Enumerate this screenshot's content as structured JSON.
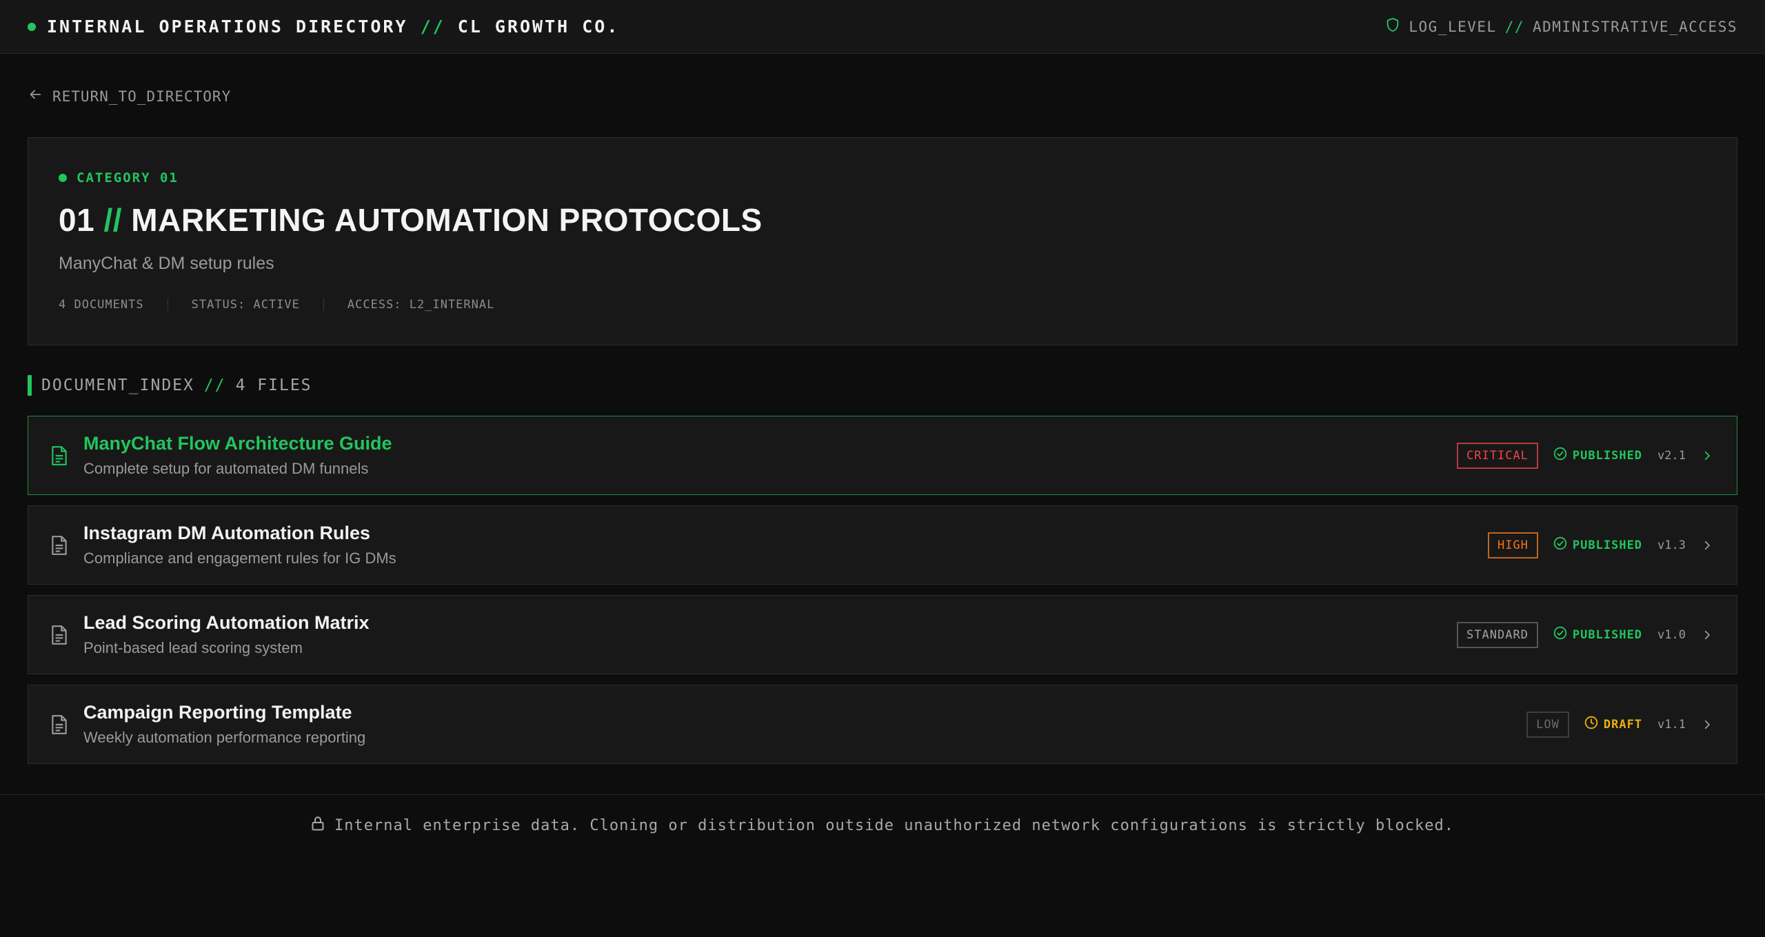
{
  "header": {
    "brand_main": "INTERNAL OPERATIONS DIRECTORY",
    "brand_sep": "//",
    "brand_org": "CL GROWTH CO.",
    "access_label": "LOG_LEVEL",
    "access_sep": "//",
    "access_value": "ADMINISTRATIVE_ACCESS"
  },
  "nav": {
    "back_label": "RETURN_TO_DIRECTORY"
  },
  "category": {
    "tag": "CATEGORY 01",
    "number": "01",
    "sep": "//",
    "title": "MARKETING AUTOMATION PROTOCOLS",
    "subtitle": "ManyChat & DM setup rules",
    "meta": {
      "documents": "4 DOCUMENTS",
      "status": "STATUS: ACTIVE",
      "access": "ACCESS: L2_INTERNAL"
    }
  },
  "index": {
    "label": "DOCUMENT_INDEX",
    "sep": "//",
    "count": "4 FILES"
  },
  "documents": [
    {
      "title": "ManyChat Flow Architecture Guide",
      "desc": "Complete setup for automated DM funnels",
      "priority": "CRITICAL",
      "status": "PUBLISHED",
      "version": "v2.1"
    },
    {
      "title": "Instagram DM Automation Rules",
      "desc": "Compliance and engagement rules for IG DMs",
      "priority": "HIGH",
      "status": "PUBLISHED",
      "version": "v1.3"
    },
    {
      "title": "Lead Scoring Automation Matrix",
      "desc": "Point-based lead scoring system",
      "priority": "STANDARD",
      "status": "PUBLISHED",
      "version": "v1.0"
    },
    {
      "title": "Campaign Reporting Template",
      "desc": "Weekly automation performance reporting",
      "priority": "LOW",
      "status": "DRAFT",
      "version": "v1.1"
    }
  ],
  "footer": {
    "note": "Internal enterprise data. Cloning or distribution outside unauthorized network configurations is strictly blocked."
  },
  "colors": {
    "accent": "#22c55e",
    "critical": "#ef4444",
    "high": "#f97316",
    "draft": "#eab308"
  },
  "icons": [
    "status-dot",
    "shield-icon",
    "arrow-left-icon",
    "file-text-icon",
    "check-circle-icon",
    "clock-icon",
    "chevron-right-icon",
    "lock-icon"
  ]
}
